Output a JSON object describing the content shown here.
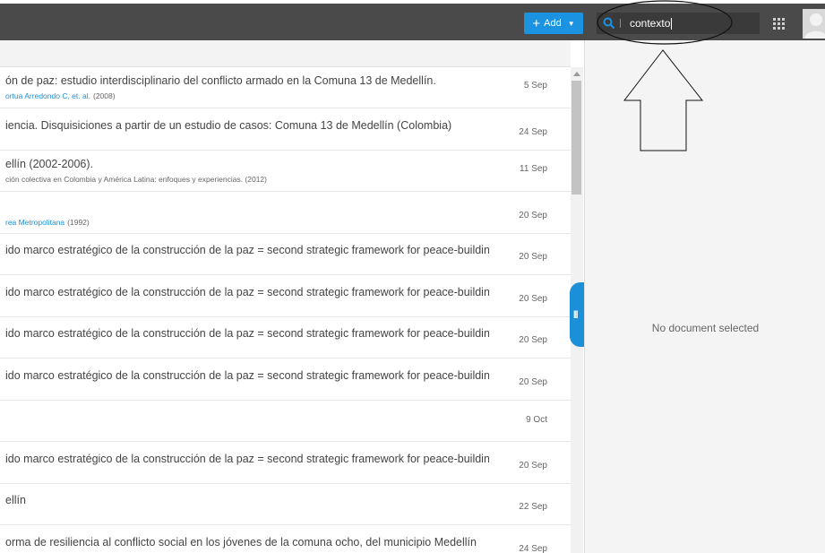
{
  "toolbar": {
    "add_label": "Add",
    "add_icon": "plus-icon",
    "search_value": "contexto",
    "accent_color": "#1b93e0"
  },
  "documents": [
    {
      "title": "ón de paz: estudio interdisciplinario del conflicto armado en la Comuna 13 de Medellín.",
      "author": "ortua Arredondo C, et. al.",
      "year": "(2008)",
      "source": "",
      "date": "5 Sep"
    },
    {
      "title": "iencia. Disquisiciones a partir de un estudio de casos: Comuna 13 de Medellín (Colombia)",
      "author": "",
      "year": "",
      "source": "",
      "date": "24 Sep"
    },
    {
      "title": "ellín (2002-2006).",
      "author": "",
      "year": "",
      "source": "ción colectiva en Colombia y América Latina: enfoques y experiencias. (2012)",
      "date": "11 Sep"
    },
    {
      "title": "",
      "author": "rea Metropolitana",
      "year": "(1992)",
      "source": "",
      "date": "20 Sep"
    },
    {
      "title": "ido marco estratégico de la construcción de la paz = second strategic framework for peace-building i...",
      "author": "",
      "year": "",
      "source": "",
      "date": "20 Sep"
    },
    {
      "title": "ido marco estratégico de la construcción de la paz = second strategic framework for peace-building i...",
      "author": "",
      "year": "",
      "source": "",
      "date": "20 Sep"
    },
    {
      "title": "ido marco estratégico de la construcción de la paz = second strategic framework for peace-building i...",
      "author": "",
      "year": "",
      "source": "",
      "date": "20 Sep"
    },
    {
      "title": "ido marco estratégico de la construcción de la paz = second strategic framework for peace-building i...",
      "author": "",
      "year": "",
      "source": "",
      "date": "20 Sep"
    },
    {
      "title": "",
      "author": "",
      "year": "",
      "source": "",
      "date": "9 Oct"
    },
    {
      "title": "ido marco estratégico de la construcción de la paz = second strategic framework for peace-building i...",
      "author": "",
      "year": "",
      "source": "",
      "date": "20 Sep"
    },
    {
      "title": "ellín",
      "author": "",
      "year": "",
      "source": "",
      "date": "22 Sep"
    },
    {
      "title": "orma de resiliencia al conflicto social en los jóvenes de la comuna ocho, del municipio Medellín",
      "author": "",
      "year": "",
      "source": "",
      "date": "24 Sep"
    }
  ],
  "detail": {
    "empty_message": "No document selected"
  }
}
